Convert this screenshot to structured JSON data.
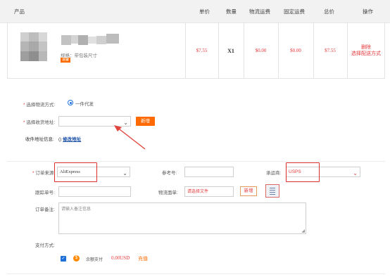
{
  "table": {
    "headers": {
      "product": "产品",
      "unit_price": "单价",
      "quantity": "数量",
      "shipping_fee": "物流运费",
      "fixed_fee": "固定运费",
      "total": "总价",
      "action": "操作"
    },
    "row": {
      "spec_label": "规格：",
      "spec_value": "带包装尺寸",
      "badge": "温馨",
      "unit_price": "$7.55",
      "quantity": "X1",
      "shipping_fee": "$0.00",
      "fixed_fee": "$0.00",
      "total": "$7.55",
      "delete_link": "删除",
      "choose_shipping_link": "选择配送方式"
    }
  },
  "shipping_method": {
    "label": "选择物流方式:",
    "option": "一件代发"
  },
  "address": {
    "label": "选择收货地址:",
    "value": "",
    "add_button": "新增",
    "info_label": "收件地址信息:",
    "info_value": "()",
    "edit_link": "修改地址"
  },
  "order": {
    "source_label": "订单来源:",
    "source_value": "AliExpress",
    "ref_label": "参考号:",
    "ref_value": "",
    "carrier_label": "承运商:",
    "carrier_value": "USPS",
    "tracking_label": "跟踪单号:",
    "tracking_value": "",
    "waybill_label": "物流面单:",
    "waybill_placeholder": "请选择文件",
    "waybill_add_button": "新增",
    "note_label": "订单备注:",
    "note_placeholder": "请输入备注信息",
    "payment_label": "支付方式:",
    "balance_label": "余额支付",
    "balance_amount": "0.00USD",
    "recharge_link": "充值"
  },
  "colors": {
    "accent": "#ff6a00",
    "red": "#e4393c",
    "highlight_box": "#d9302b",
    "radio": "#1e6fd9"
  }
}
